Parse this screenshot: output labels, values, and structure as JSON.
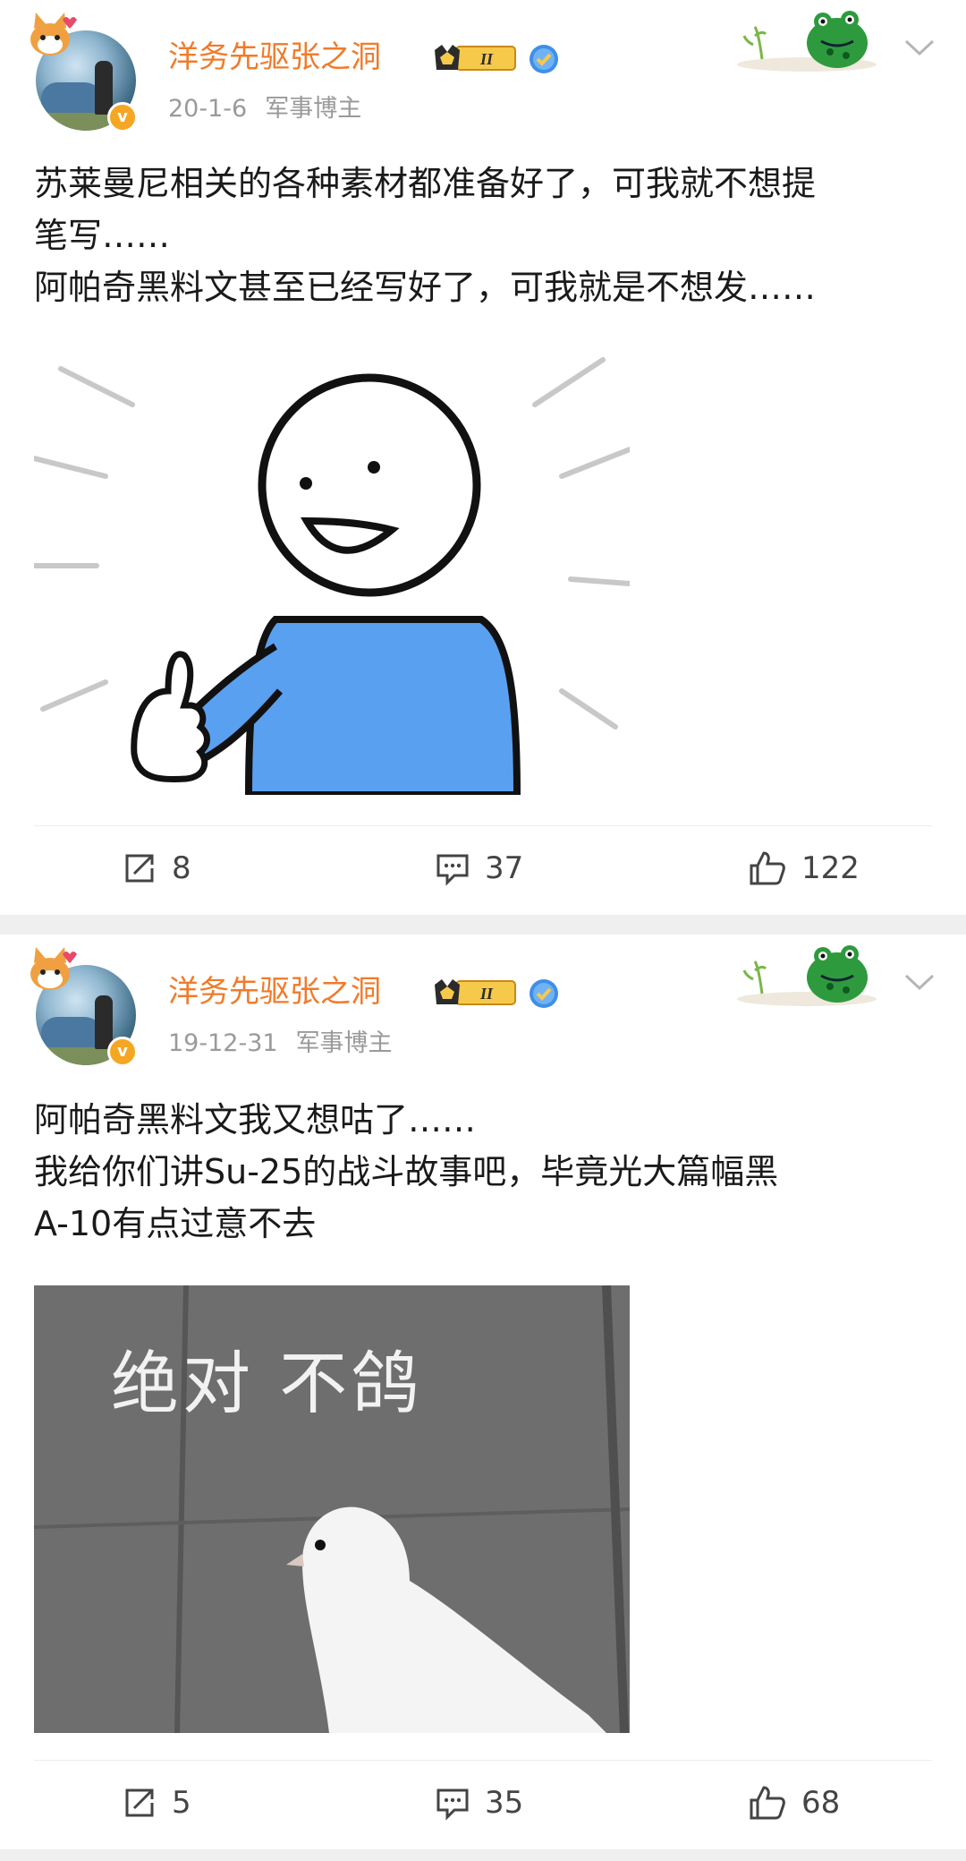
{
  "posts": [
    {
      "author": "洋务先驱张之洞",
      "date": "20-1-6",
      "tag": "军事博主",
      "lines": [
        "苏莱曼尼相关的各种素材都准备好了，可我就不想提",
        "笔写……",
        "阿帕奇黑料文甚至已经写好了，可我就是不想发……"
      ],
      "image_caption": "",
      "reposts": "8",
      "comments": "37",
      "likes": "122"
    },
    {
      "author": "洋务先驱张之洞",
      "date": "19-12-31",
      "tag": "军事博主",
      "lines": [
        "阿帕奇黑料文我又想咕了……",
        "我给你们讲Su-25的战斗故事吧，毕竟光大篇幅黑",
        "A-10有点过意不去"
      ],
      "image_caption": "绝对 不鸽",
      "reposts": "5",
      "comments": "35",
      "likes": "68"
    }
  ],
  "badges": {
    "vip_level": "II",
    "verified_icon": "verified-icon",
    "v_mark": "v"
  },
  "colors": {
    "author": "#f07b2a",
    "meta": "#9a9a9a",
    "separator": "#efefef",
    "figure_shirt": "#5aa0f0"
  },
  "icons": [
    "repost-icon",
    "comment-icon",
    "like-icon",
    "chevron-down-icon",
    "frog-decoration-icon",
    "cat-sticker-icon"
  ]
}
